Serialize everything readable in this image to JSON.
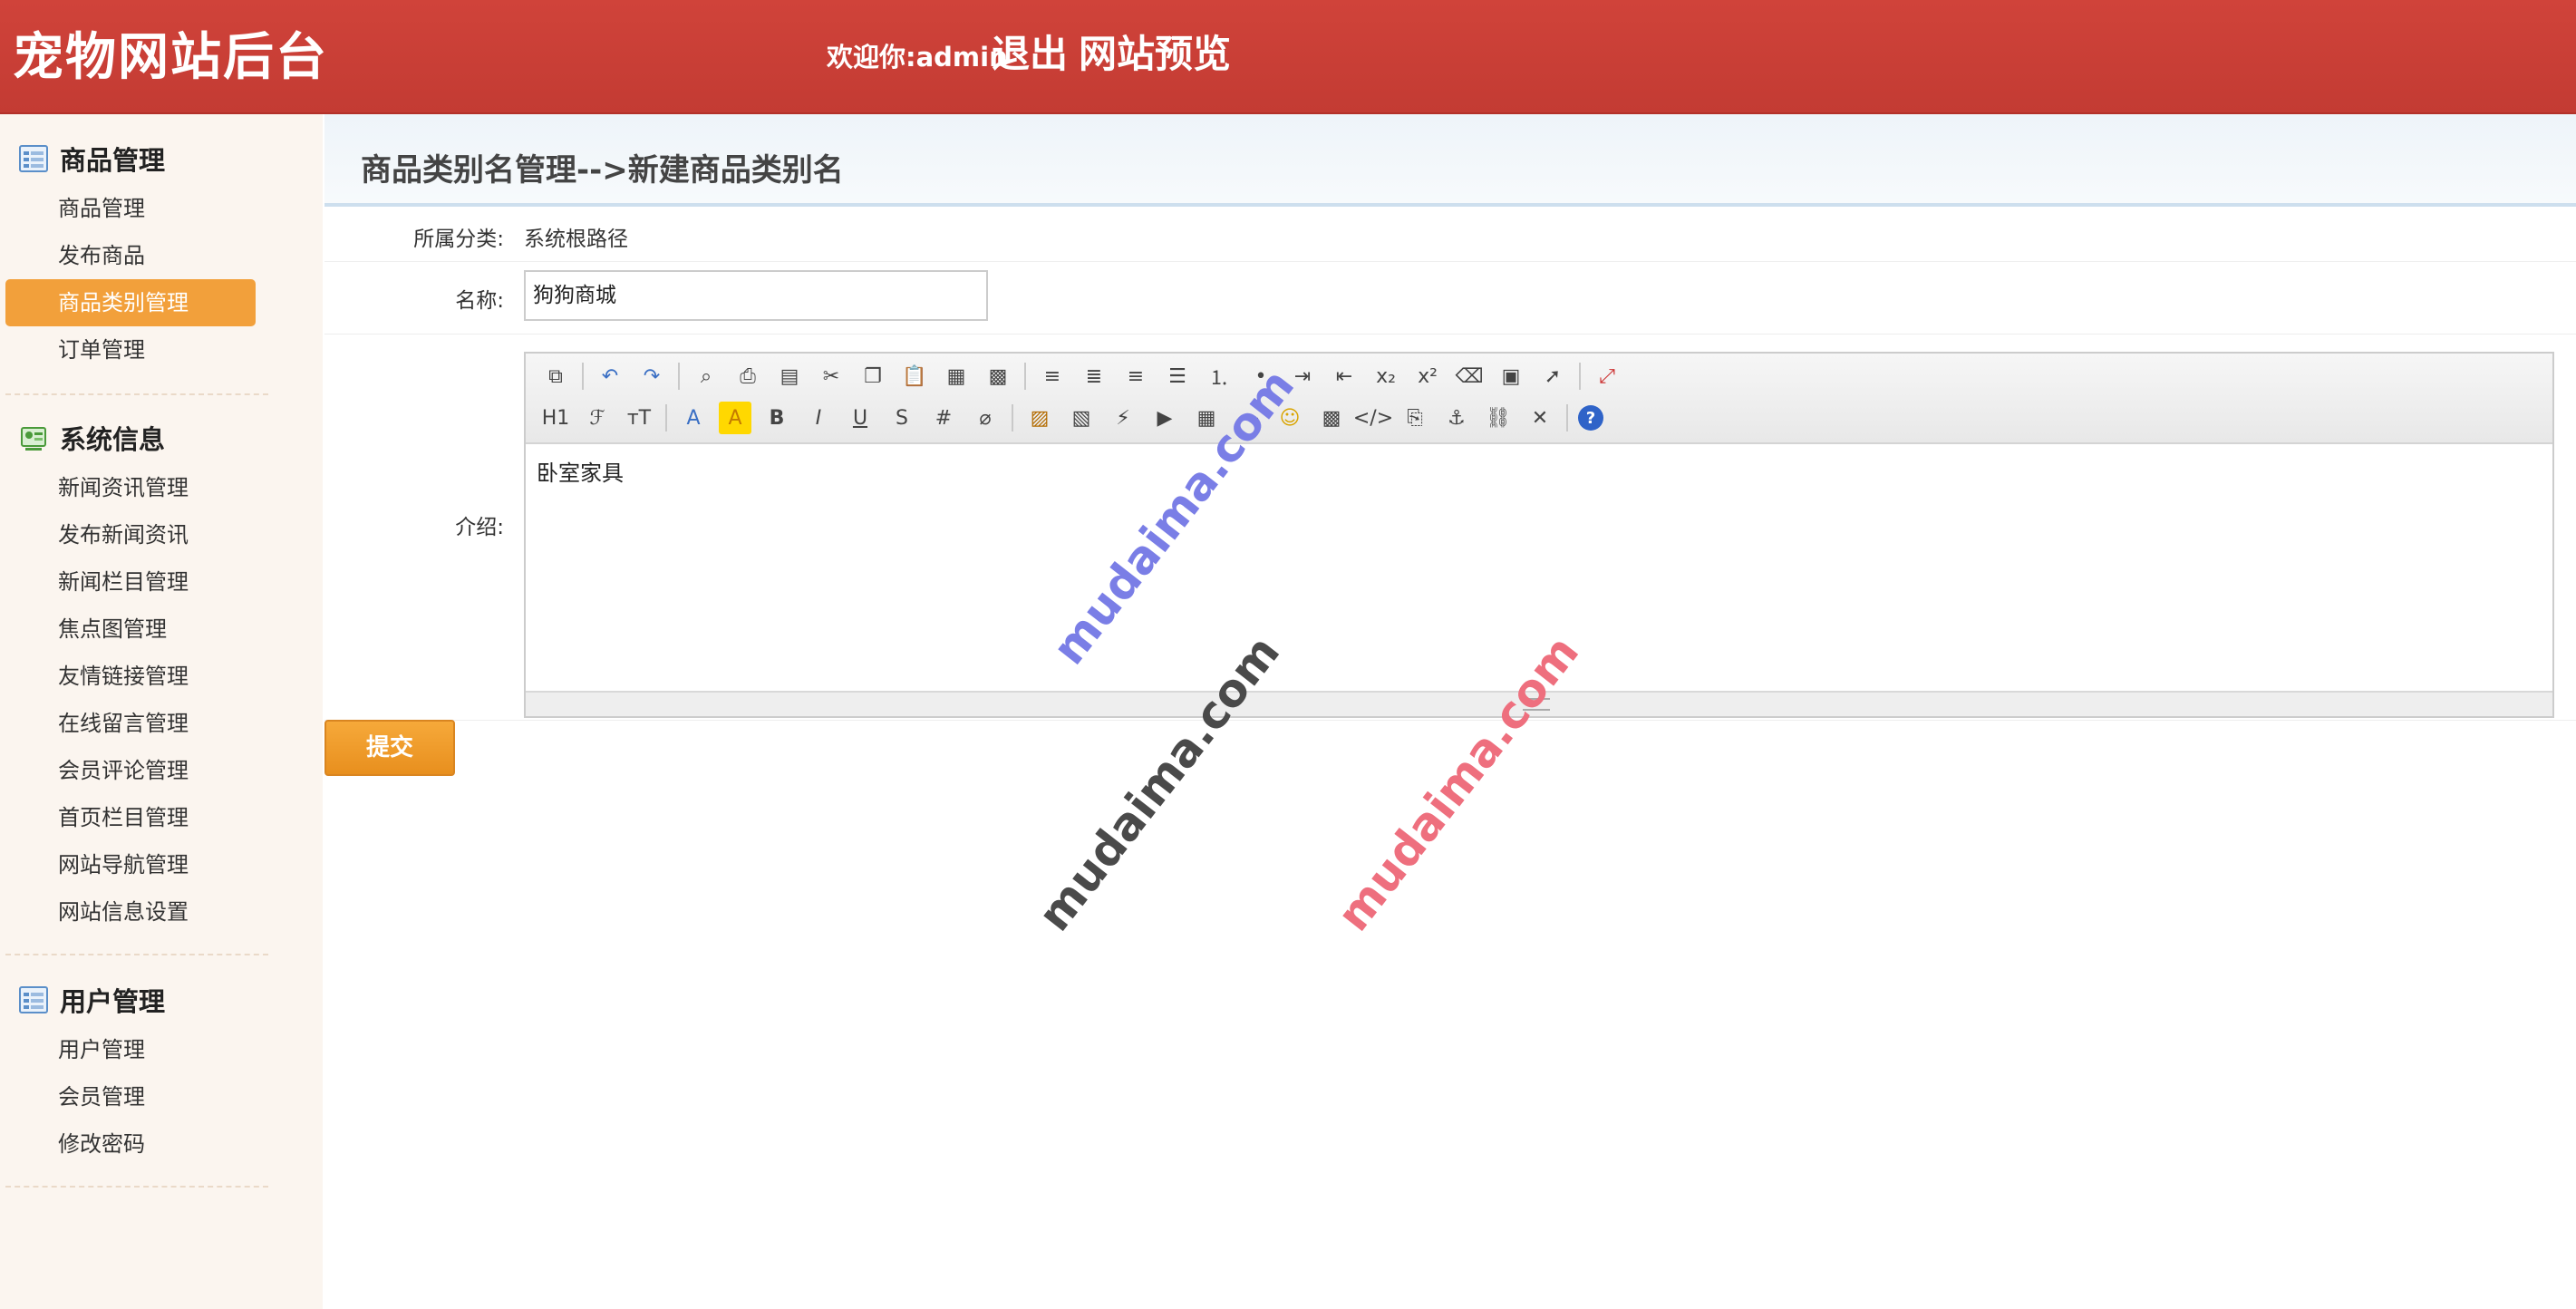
{
  "header": {
    "app_title": "宠物网站后台",
    "welcome": "欢迎你:admin",
    "logout": "退出",
    "preview": "网站预览"
  },
  "sidebar": {
    "sections": [
      {
        "title": "商品管理",
        "icon": "list-icon",
        "items": [
          "商品管理",
          "发布商品",
          "商品类别管理",
          "订单管理"
        ]
      },
      {
        "title": "系统信息",
        "icon": "system-info-icon",
        "items": [
          "新闻资讯管理",
          "发布新闻资讯",
          "新闻栏目管理",
          "焦点图管理",
          "友情链接管理",
          "在线留言管理",
          "会员评论管理",
          "首页栏目管理",
          "网站导航管理",
          "网站信息设置"
        ]
      },
      {
        "title": "用户管理",
        "icon": "list-icon",
        "items": [
          "用户管理",
          "会员管理",
          "修改密码"
        ]
      }
    ],
    "active_item": "商品类别管理"
  },
  "page": {
    "title": "商品类别名管理-->新建商品类别名",
    "category_label": "所属分类:",
    "category_value": "系统根路径",
    "name_label": "名称:",
    "name_value": "狗狗商城",
    "intro_label": "介绍:",
    "intro_value": "卧室家具",
    "submit_label": "提交"
  },
  "editor_toolbar": {
    "row1": [
      "source-icon",
      "|",
      "undo-icon",
      "redo-icon",
      "|",
      "preview-icon",
      "print-icon",
      "template-icon",
      "cut-icon",
      "copy-icon",
      "paste-icon",
      "paste-text-icon",
      "paste-word-icon",
      "|",
      "align-left-icon",
      "align-center-icon",
      "align-right-icon",
      "align-justify-icon",
      "ordered-list-icon",
      "unordered-list-icon",
      "indent-icon",
      "outdent-icon",
      "subscript-icon",
      "superscript-icon",
      "clear-format-icon",
      "select-all-icon",
      "pointer-icon",
      "|",
      "fullscreen-icon"
    ],
    "row2": [
      "heading-icon",
      "font-family-icon",
      "font-size-icon",
      "|",
      "font-color-icon",
      "highlight-color-icon",
      "bold-icon",
      "italic-icon",
      "underline-icon",
      "strikethrough-icon",
      "line-height-icon",
      "remove-format-icon",
      "|",
      "image-icon",
      "multi-image-icon",
      "flash-icon",
      "media-icon",
      "table-icon",
      "hr-icon",
      "emoticon-icon",
      "map-icon",
      "code-icon",
      "page-break-icon",
      "anchor-icon",
      "link-icon",
      "unlink-icon",
      "|",
      "help-icon"
    ]
  },
  "watermarks": [
    "mudaima.com",
    "mudaima.com",
    "mudaima.com"
  ],
  "colors": {
    "header_bg": "#c9403a",
    "active_item_bg": "#f2a03b",
    "submit_bg": "#f0a035"
  }
}
